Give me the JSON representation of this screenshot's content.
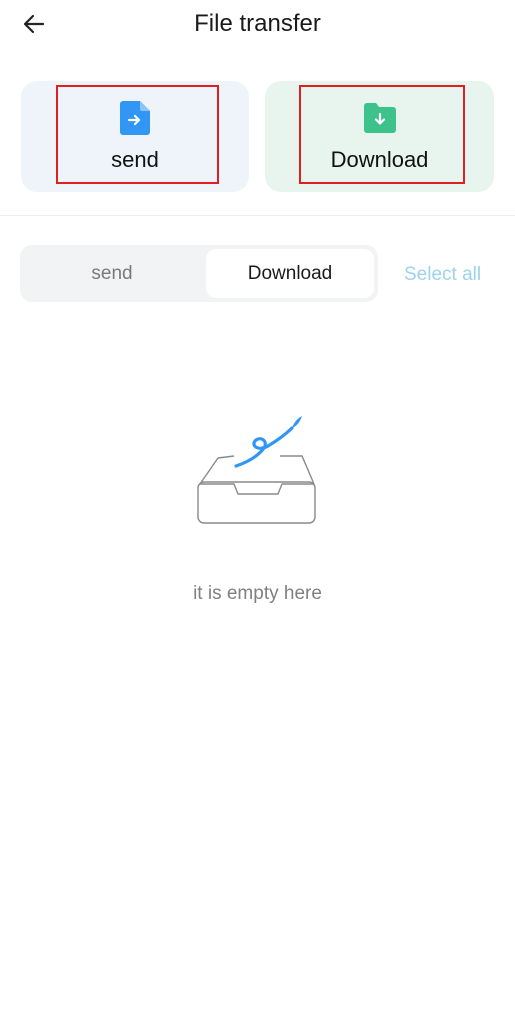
{
  "header": {
    "title": "File transfer",
    "back_icon": "back-arrow-icon"
  },
  "cards": {
    "send": {
      "label": "send",
      "icon": "file-send-icon"
    },
    "download": {
      "label": "Download",
      "icon": "folder-download-icon"
    }
  },
  "segment": {
    "send_label": "send",
    "download_label": "Download",
    "selected": "Download"
  },
  "select_all_label": "Select all",
  "empty": {
    "icon": "empty-tray-icon",
    "text": "it is empty here"
  },
  "colors": {
    "accent": "#9bd3ec",
    "send_icon": "#3296f5",
    "download_icon": "#3cc28a",
    "send_card_bg": "#eef4fa",
    "download_card_bg": "#e8f5ee",
    "highlight": "#e02020"
  }
}
